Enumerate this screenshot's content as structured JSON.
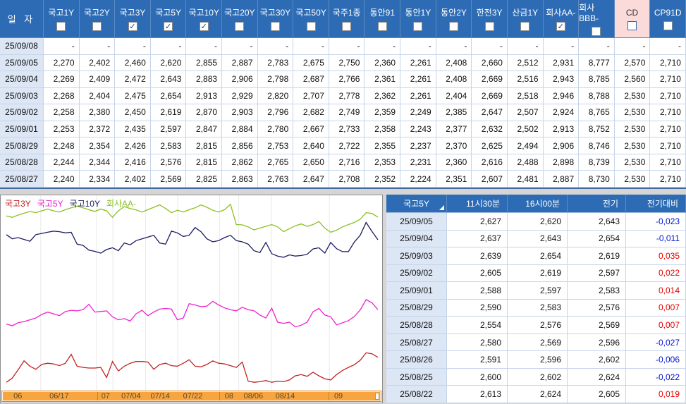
{
  "top_table": {
    "date_header": "일  자",
    "columns": [
      {
        "label": "국고1Y",
        "checked": false,
        "highlight": false
      },
      {
        "label": "국고2Y",
        "checked": false,
        "highlight": false
      },
      {
        "label": "국고3Y",
        "checked": true,
        "highlight": false
      },
      {
        "label": "국고5Y",
        "checked": true,
        "highlight": false
      },
      {
        "label": "국고10Y",
        "checked": true,
        "highlight": false
      },
      {
        "label": "국고20Y",
        "checked": false,
        "highlight": false
      },
      {
        "label": "국고30Y",
        "checked": false,
        "highlight": false
      },
      {
        "label": "국고50Y",
        "checked": false,
        "highlight": false
      },
      {
        "label": "국주1종",
        "checked": false,
        "highlight": false
      },
      {
        "label": "통안91",
        "checked": false,
        "highlight": false
      },
      {
        "label": "통안1Y",
        "checked": false,
        "highlight": false
      },
      {
        "label": "통안2Y",
        "checked": false,
        "highlight": false
      },
      {
        "label": "한전3Y",
        "checked": false,
        "highlight": false
      },
      {
        "label": "산금1Y",
        "checked": false,
        "highlight": false
      },
      {
        "label": "회사AA-",
        "checked": true,
        "highlight": false
      },
      {
        "label": "회사BBB-",
        "checked": false,
        "highlight": false
      },
      {
        "label": "CD",
        "checked": false,
        "highlight": true
      },
      {
        "label": "CP91D",
        "checked": false,
        "highlight": false
      }
    ],
    "rows": [
      {
        "date": "25/09/08",
        "values": [
          "-",
          "-",
          "-",
          "-",
          "-",
          "-",
          "-",
          "-",
          "-",
          "-",
          "-",
          "-",
          "-",
          "-",
          "-",
          "-",
          "-",
          "-"
        ]
      },
      {
        "date": "25/09/05",
        "values": [
          "2,270",
          "2,402",
          "2,460",
          "2,620",
          "2,855",
          "2,887",
          "2,783",
          "2,675",
          "2,750",
          "2,360",
          "2,261",
          "2,408",
          "2,660",
          "2,512",
          "2,931",
          "8,777",
          "2,570",
          "2,710"
        ]
      },
      {
        "date": "25/09/04",
        "values": [
          "2,269",
          "2,409",
          "2,472",
          "2,643",
          "2,883",
          "2,906",
          "2,798",
          "2,687",
          "2,766",
          "2,361",
          "2,261",
          "2,408",
          "2,669",
          "2,516",
          "2,943",
          "8,785",
          "2,560",
          "2,710"
        ]
      },
      {
        "date": "25/09/03",
        "values": [
          "2,268",
          "2,404",
          "2,475",
          "2,654",
          "2,913",
          "2,929",
          "2,820",
          "2,707",
          "2,778",
          "2,362",
          "2,261",
          "2,404",
          "2,669",
          "2,518",
          "2,946",
          "8,788",
          "2,530",
          "2,710"
        ]
      },
      {
        "date": "25/09/02",
        "values": [
          "2,258",
          "2,380",
          "2,450",
          "2,619",
          "2,870",
          "2,903",
          "2,796",
          "2,682",
          "2,749",
          "2,359",
          "2,249",
          "2,385",
          "2,647",
          "2,507",
          "2,924",
          "8,765",
          "2,530",
          "2,710"
        ]
      },
      {
        "date": "25/09/01",
        "values": [
          "2,253",
          "2,372",
          "2,435",
          "2,597",
          "2,847",
          "2,884",
          "2,780",
          "2,667",
          "2,733",
          "2,358",
          "2,243",
          "2,377",
          "2,632",
          "2,502",
          "2,913",
          "8,752",
          "2,530",
          "2,710"
        ]
      },
      {
        "date": "25/08/29",
        "values": [
          "2,248",
          "2,354",
          "2,426",
          "2,583",
          "2,815",
          "2,856",
          "2,753",
          "2,640",
          "2,722",
          "2,355",
          "2,237",
          "2,370",
          "2,625",
          "2,494",
          "2,906",
          "8,746",
          "2,530",
          "2,710"
        ]
      },
      {
        "date": "25/08/28",
        "values": [
          "2,244",
          "2,344",
          "2,416",
          "2,576",
          "2,815",
          "2,862",
          "2,765",
          "2,650",
          "2,716",
          "2,353",
          "2,231",
          "2,360",
          "2,616",
          "2,488",
          "2,898",
          "8,739",
          "2,530",
          "2,710"
        ]
      },
      {
        "date": "25/08/27",
        "values": [
          "2,240",
          "2,334",
          "2,402",
          "2,569",
          "2,825",
          "2,863",
          "2,763",
          "2,647",
          "2,708",
          "2,352",
          "2,224",
          "2,351",
          "2,607",
          "2,481",
          "2,887",
          "8,730",
          "2,530",
          "2,710"
        ]
      }
    ]
  },
  "chart_data": {
    "type": "line",
    "ylim": [
      2.36,
      2.99
    ],
    "legend_position": "top-left",
    "grid": true,
    "series": [
      {
        "name": "국고3Y",
        "color": "#c22222",
        "values": [
          2.376,
          2.39,
          2.418,
          2.448,
          2.43,
          2.42,
          2.436,
          2.44,
          2.438,
          2.432,
          2.44,
          2.47,
          2.43,
          2.426,
          2.424,
          2.424,
          2.426,
          2.392,
          2.446,
          2.414,
          2.43,
          2.44,
          2.446,
          2.446,
          2.444,
          2.42,
          2.436,
          2.44,
          2.432,
          2.43,
          2.44,
          2.452,
          2.43,
          2.428,
          2.436,
          2.448,
          2.44,
          2.438,
          2.432,
          2.426,
          2.444,
          2.38,
          2.376,
          2.378,
          2.382,
          2.376,
          2.38,
          2.378,
          2.384,
          2.398,
          2.402,
          2.396,
          2.41,
          2.398,
          2.388,
          2.384,
          2.402,
          2.416,
          2.426,
          2.435,
          2.45,
          2.475,
          2.472,
          2.46
        ]
      },
      {
        "name": "국고5Y",
        "color": "#ee22cc",
        "values": [
          2.572,
          2.566,
          2.576,
          2.58,
          2.586,
          2.592,
          2.604,
          2.612,
          2.606,
          2.6,
          2.614,
          2.618,
          2.616,
          2.62,
          2.638,
          2.612,
          2.614,
          2.616,
          2.596,
          2.586,
          2.59,
          2.582,
          2.606,
          2.618,
          2.6,
          2.612,
          2.622,
          2.624,
          2.622,
          2.586,
          2.592,
          2.64,
          2.636,
          2.63,
          2.632,
          2.648,
          2.636,
          2.626,
          2.62,
          2.616,
          2.628,
          2.62,
          2.616,
          2.602,
          2.592,
          2.625,
          2.578,
          2.574,
          2.578,
          2.562,
          2.568,
          2.578,
          2.613,
          2.624,
          2.602,
          2.596,
          2.569,
          2.576,
          2.583,
          2.597,
          2.619,
          2.654,
          2.643,
          2.62
        ]
      },
      {
        "name": "국고10Y",
        "color": "#1b1b60",
        "values": [
          2.872,
          2.858,
          2.862,
          2.856,
          2.85,
          2.872,
          2.876,
          2.88,
          2.884,
          2.882,
          2.878,
          2.88,
          2.84,
          2.836,
          2.82,
          2.816,
          2.81,
          2.822,
          2.828,
          2.818,
          2.844,
          2.838,
          2.852,
          2.858,
          2.864,
          2.87,
          2.844,
          2.84,
          2.884,
          2.878,
          2.866,
          2.87,
          2.896,
          2.882,
          2.858,
          2.848,
          2.852,
          2.862,
          2.87,
          2.852,
          2.848,
          2.84,
          2.818,
          2.812,
          2.846,
          2.808,
          2.8,
          2.796,
          2.804,
          2.8,
          2.802,
          2.806,
          2.824,
          2.828,
          2.81,
          2.846,
          2.825,
          2.815,
          2.815,
          2.847,
          2.87,
          2.913,
          2.883,
          2.855
        ]
      },
      {
        "name": "회사AA-",
        "color": "#8ac122",
        "values": [
          2.935,
          2.93,
          2.938,
          2.944,
          2.95,
          2.946,
          2.952,
          2.958,
          2.952,
          2.948,
          2.956,
          2.962,
          2.968,
          2.962,
          2.956,
          2.95,
          2.958,
          2.952,
          2.93,
          2.952,
          2.966,
          2.96,
          2.955,
          2.948,
          2.956,
          2.964,
          2.972,
          2.96,
          2.946,
          2.954,
          2.948,
          2.956,
          2.962,
          2.972,
          2.964,
          2.954,
          2.948,
          2.956,
          2.974,
          2.906,
          2.905,
          2.898,
          2.888,
          2.894,
          2.9,
          2.906,
          2.898,
          2.882,
          2.892,
          2.902,
          2.908,
          2.9,
          2.906,
          2.916,
          2.894,
          2.88,
          2.887,
          2.898,
          2.906,
          2.913,
          2.924,
          2.946,
          2.943,
          2.931
        ]
      }
    ],
    "gridlines": [
      0.105,
      0.251,
      0.294,
      0.38,
      0.464,
      0.574,
      0.624,
      0.71,
      0.862
    ],
    "x_labels": [
      {
        "text": "06",
        "pos": 0.03
      },
      {
        "text": "06/17",
        "pos": 0.125
      },
      {
        "text": "07",
        "pos": 0.262
      },
      {
        "text": "07/04",
        "pos": 0.315
      },
      {
        "text": "07/14",
        "pos": 0.392
      },
      {
        "text": "07/22",
        "pos": 0.478
      },
      {
        "text": "08",
        "pos": 0.588
      },
      {
        "text": "08/06",
        "pos": 0.638
      },
      {
        "text": "08/14",
        "pos": 0.722
      },
      {
        "text": "09",
        "pos": 0.877
      }
    ],
    "scroll_ticks": [
      0.251,
      0.574,
      0.862
    ]
  },
  "bottom_table": {
    "selector_label": "국고5Y",
    "columns": [
      "11시30분",
      "16시00분",
      "전기",
      "전기대비"
    ],
    "rows": [
      {
        "date": "25/09/05",
        "t1130": "2,627",
        "t1600": "2,620",
        "prev": "2,643",
        "diff": "-0,023"
      },
      {
        "date": "25/09/04",
        "t1130": "2,637",
        "t1600": "2,643",
        "prev": "2,654",
        "diff": "-0,011"
      },
      {
        "date": "25/09/03",
        "t1130": "2,639",
        "t1600": "2,654",
        "prev": "2,619",
        "diff": "0,035"
      },
      {
        "date": "25/09/02",
        "t1130": "2,605",
        "t1600": "2,619",
        "prev": "2,597",
        "diff": "0,022"
      },
      {
        "date": "25/09/01",
        "t1130": "2,588",
        "t1600": "2,597",
        "prev": "2,583",
        "diff": "0,014"
      },
      {
        "date": "25/08/29",
        "t1130": "2,590",
        "t1600": "2,583",
        "prev": "2,576",
        "diff": "0,007"
      },
      {
        "date": "25/08/28",
        "t1130": "2,554",
        "t1600": "2,576",
        "prev": "2,569",
        "diff": "0,007"
      },
      {
        "date": "25/08/27",
        "t1130": "2,580",
        "t1600": "2,569",
        "prev": "2,596",
        "diff": "-0,027"
      },
      {
        "date": "25/08/26",
        "t1130": "2,591",
        "t1600": "2,596",
        "prev": "2,602",
        "diff": "-0,006"
      },
      {
        "date": "25/08/25",
        "t1130": "2,600",
        "t1600": "2,602",
        "prev": "2,624",
        "diff": "-0,022"
      },
      {
        "date": "25/08/22",
        "t1130": "2,613",
        "t1600": "2,624",
        "prev": "2,605",
        "diff": "0,019"
      }
    ]
  },
  "colors": {
    "header_blue": "#2d6cb5",
    "highlight_pink": "#fbdada",
    "date_cell_blue": "#dce6f4",
    "negative_blue": "#0014d2",
    "positive_red": "#e60000",
    "scrollbar_orange": "#f8a540"
  }
}
